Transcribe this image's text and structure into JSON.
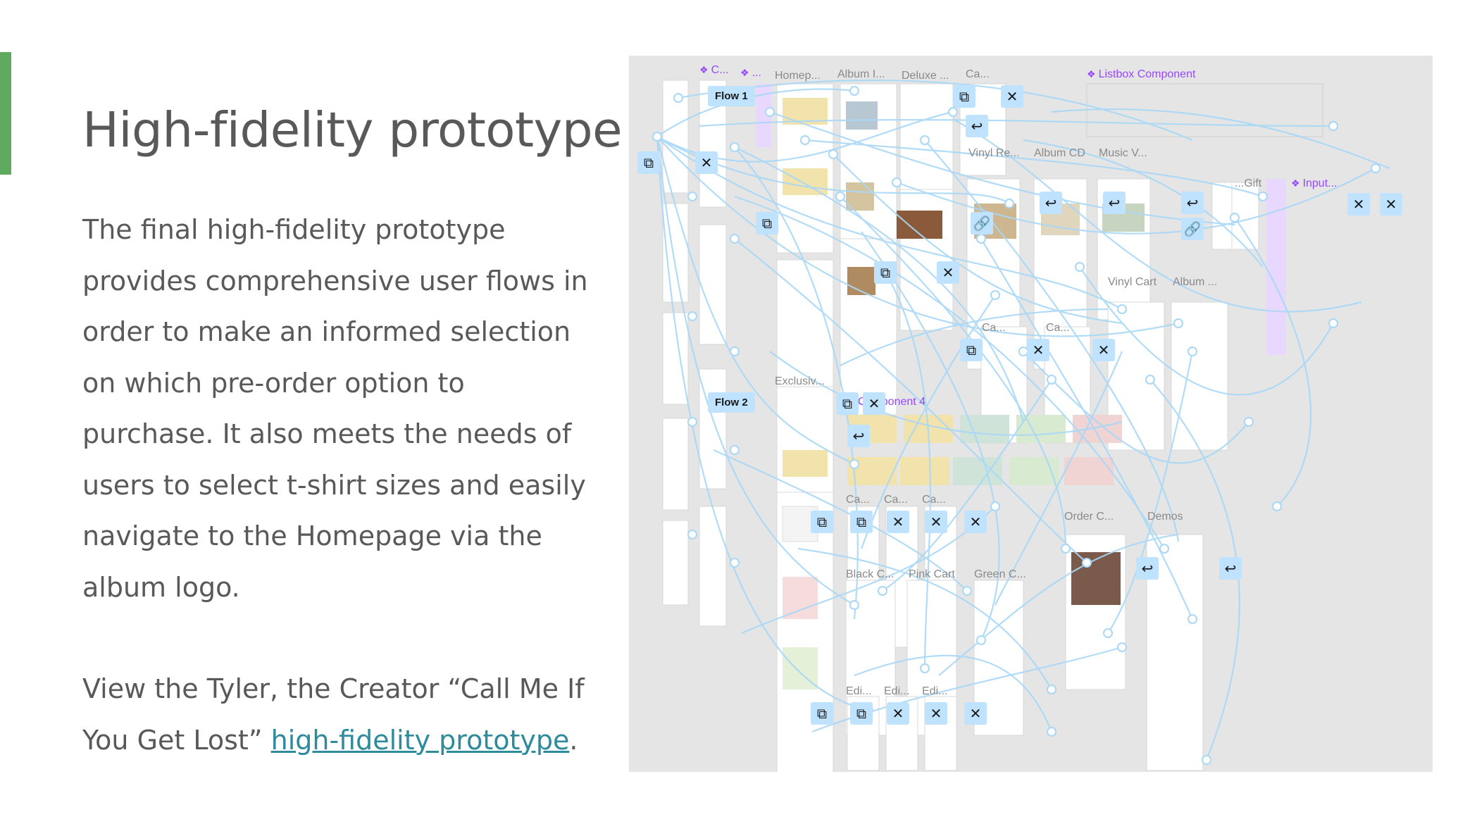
{
  "slide": {
    "title": "High-fidelity prototype",
    "paragraph1": "The final high-fidelity prototype provides comprehensive user flows in order to make an informed selection on which pre-order option to purchase. It also meets the needs of users to select t-shirt sizes and easily navigate to the Homepage via the album logo.",
    "paragraph2_prefix": "View the Tyler, the Creator “Call Me If You Get Lost” ",
    "paragraph2_link": "high-fidelity prototype",
    "paragraph2_suffix": ".",
    "accent_color": "#5faa5f",
    "link_color": "#2e8b9c"
  },
  "canvas": {
    "frame_labels": {
      "homepage": "Homep...",
      "album": "Album I...",
      "deluxe": "Deluxe ...",
      "ca_top": "Ca...",
      "vinyl_re": "Vinyl Re...",
      "album_cd": "Album CD",
      "music_v": "Music V...",
      "vinyl_cart": "Vinyl Cart",
      "album_cart": "Album ...",
      "exclusive": "Exclusiv...",
      "ca_mid1": "Ca...",
      "ca_mid2": "Ca...",
      "ca_low1": "Ca...",
      "ca_low2": "Ca...",
      "ca_low3": "Ca...",
      "order_c": "Order C...",
      "demos": "Demos",
      "black_c": "Black C...",
      "pink_cart": "Pink Cart",
      "green_c": "Green C...",
      "edi1": "Edi...",
      "edi2": "Edi...",
      "edi3": "Edi...",
      "gift": "...Gift"
    },
    "component_labels": {
      "c": "C...",
      "dots": "...",
      "listbox": "Listbox Component",
      "input": "Input...",
      "component4": "Component 4"
    },
    "flow_labels": {
      "flow1": "Flow 1",
      "flow2": "Flow 2"
    },
    "icons": [
      "close-icon",
      "back-arrow-icon",
      "link-icon",
      "copy-frame-icon",
      "component-diamond-icon"
    ],
    "colors": {
      "canvas_bg": "#e5e5e5",
      "connector": "#a9d8f7",
      "chip": "#bfe3ff",
      "component": "#9747ff",
      "frame_label": "#8a8a8a"
    }
  }
}
